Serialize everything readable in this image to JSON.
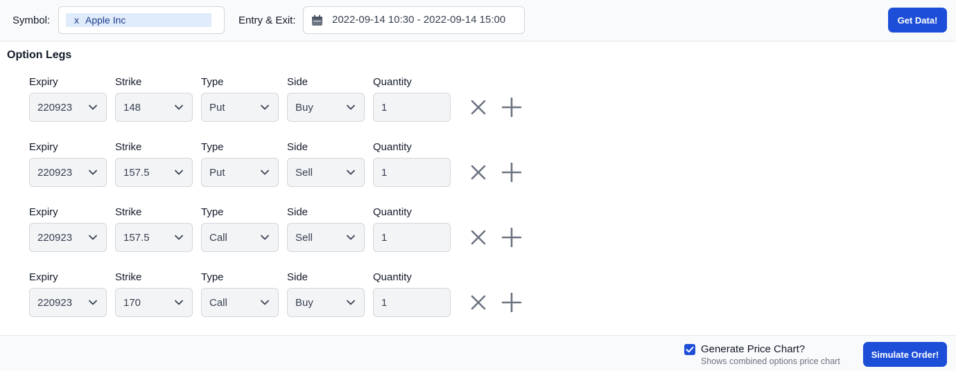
{
  "header": {
    "symbol_label": "Symbol:",
    "symbol_chip_remove": "x",
    "symbol_chip_text": "Apple Inc",
    "entry_exit_label": "Entry & Exit:",
    "date_range": "2022-09-14 10:30 - 2022-09-14 15:00",
    "get_data_label": "Get Data!"
  },
  "option_legs": {
    "title": "Option Legs",
    "field_labels": {
      "expiry": "Expiry",
      "strike": "Strike",
      "type": "Type",
      "side": "Side",
      "quantity": "Quantity"
    },
    "legs": [
      {
        "expiry": "220923",
        "strike": "148",
        "type": "Put",
        "side": "Buy",
        "quantity": "1"
      },
      {
        "expiry": "220923",
        "strike": "157.5",
        "type": "Put",
        "side": "Sell",
        "quantity": "1"
      },
      {
        "expiry": "220923",
        "strike": "157.5",
        "type": "Call",
        "side": "Sell",
        "quantity": "1"
      },
      {
        "expiry": "220923",
        "strike": "170",
        "type": "Call",
        "side": "Buy",
        "quantity": "1"
      }
    ]
  },
  "footer": {
    "generate_chart_checked": true,
    "generate_chart_label": "Generate Price Chart?",
    "generate_chart_hint": "Shows combined options price chart",
    "simulate_label": "Simulate Order!"
  },
  "colors": {
    "primary": "#1d4ed8",
    "chip_bg": "#e0ecfc",
    "field_bg": "#f3f4f6",
    "icon_gray": "#6b7280"
  },
  "icons": {
    "date": "calendar-icon",
    "dropdown": "chevron-down-icon",
    "remove_leg": "close-icon",
    "add_leg": "plus-icon",
    "checkbox": "check-icon"
  }
}
